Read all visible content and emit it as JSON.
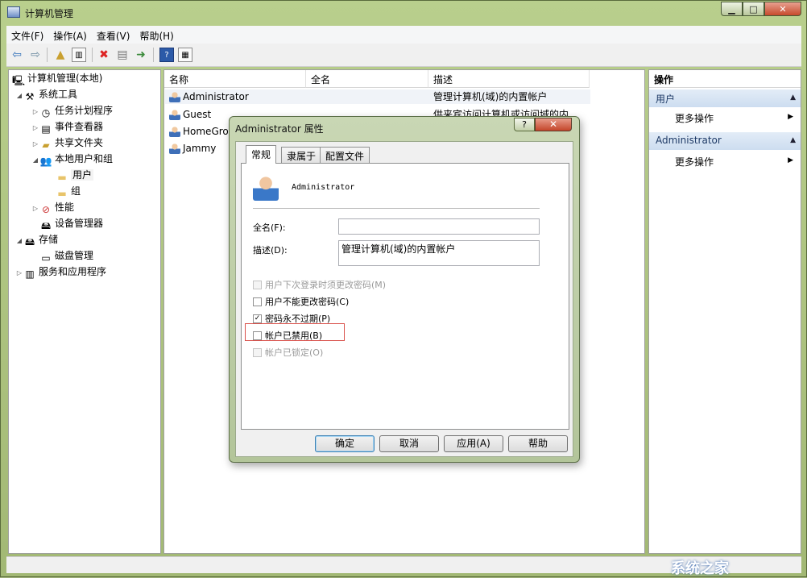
{
  "window": {
    "title": "计算机管理",
    "min": "▁",
    "max": "□",
    "close": "✕"
  },
  "menu": [
    "文件(F)",
    "操作(A)",
    "查看(V)",
    "帮助(H)"
  ],
  "toolbar_icons": [
    "back-arrow-icon",
    "forward-arrow-icon",
    "up-folder-icon",
    "show-hide-tree-icon",
    "delete-icon",
    "properties-icon",
    "export-icon",
    "help-icon",
    "action-pane-icon"
  ],
  "tree": {
    "root": "计算机管理(本地)",
    "system_tools": "系统工具",
    "task_scheduler": "任务计划程序",
    "event_viewer": "事件查看器",
    "shared_folders": "共享文件夹",
    "local_users": "本地用户和组",
    "users": "用户",
    "groups": "组",
    "performance": "性能",
    "device_manager": "设备管理器",
    "storage": "存储",
    "disk_mgmt": "磁盘管理",
    "services": "服务和应用程序"
  },
  "list": {
    "columns": [
      "名称",
      "全名",
      "描述"
    ],
    "rows": [
      {
        "name": "Administrator",
        "fullname": "",
        "desc": "管理计算机(域)的内置帐户"
      },
      {
        "name": "Guest",
        "fullname": "",
        "desc": "供来宾访问计算机或访问域的内"
      },
      {
        "name": "HomeGro",
        "fullname": "",
        "desc": ""
      },
      {
        "name": "Jammy",
        "fullname": "",
        "desc": ""
      }
    ]
  },
  "actions": {
    "header": "操作",
    "section1": "用户",
    "section1_item": "更多操作",
    "section2": "Administrator",
    "section2_item": "更多操作"
  },
  "dialog": {
    "title": "Administrator 属性",
    "help": "?",
    "close": "✕",
    "tabs": [
      "常规",
      "隶属于",
      "配置文件"
    ],
    "username": "Administrator",
    "fullname_label": "全名(F):",
    "fullname_value": "",
    "desc_label": "描述(D):",
    "desc_value": "管理计算机(域)的内置帐户",
    "checks": [
      {
        "label": "用户下次登录时须更改密码(M)",
        "checked": false,
        "disabled": true
      },
      {
        "label": "用户不能更改密码(C)",
        "checked": false,
        "disabled": false
      },
      {
        "label": "密码永不过期(P)",
        "checked": true,
        "disabled": false
      },
      {
        "label": "帐户已禁用(B)",
        "checked": false,
        "disabled": false
      },
      {
        "label": "帐户已锁定(O)",
        "checked": false,
        "disabled": true
      }
    ],
    "buttons": {
      "ok": "确定",
      "cancel": "取消",
      "apply": "应用(A)",
      "help": "帮助"
    }
  },
  "watermark": "系统之家"
}
